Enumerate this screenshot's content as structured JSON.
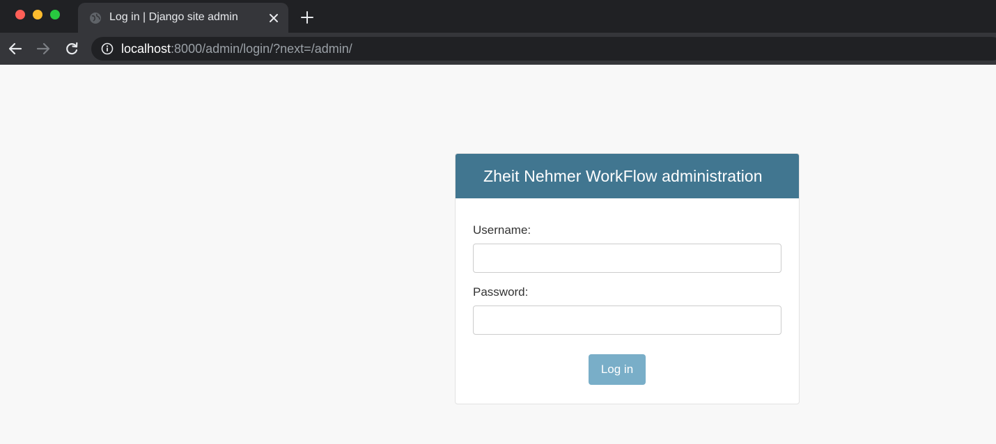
{
  "browser": {
    "tab": {
      "title": "Log in | Django site admin",
      "favicon": "globe-icon",
      "close_icon": "close-icon"
    },
    "new_tab_icon": "plus-icon",
    "nav": {
      "back_icon": "arrow-left-icon",
      "forward_icon": "arrow-right-icon",
      "reload_icon": "reload-icon"
    },
    "address": {
      "info_icon": "info-icon",
      "host": "localhost",
      "rest": ":8000/admin/login/?next=/admin/"
    },
    "traffic_lights": {
      "close": "#ff5f57",
      "minimize": "#febc2e",
      "maximize": "#28c840"
    }
  },
  "login": {
    "site_title": "Zheit Nehmer WorkFlow administration",
    "username_label": "Username:",
    "username_value": "",
    "password_label": "Password:",
    "password_value": "",
    "submit_label": "Log in"
  },
  "colors": {
    "header_bg": "#417690",
    "button_bg": "#79aec8",
    "page_bg": "#f8f8f8"
  }
}
